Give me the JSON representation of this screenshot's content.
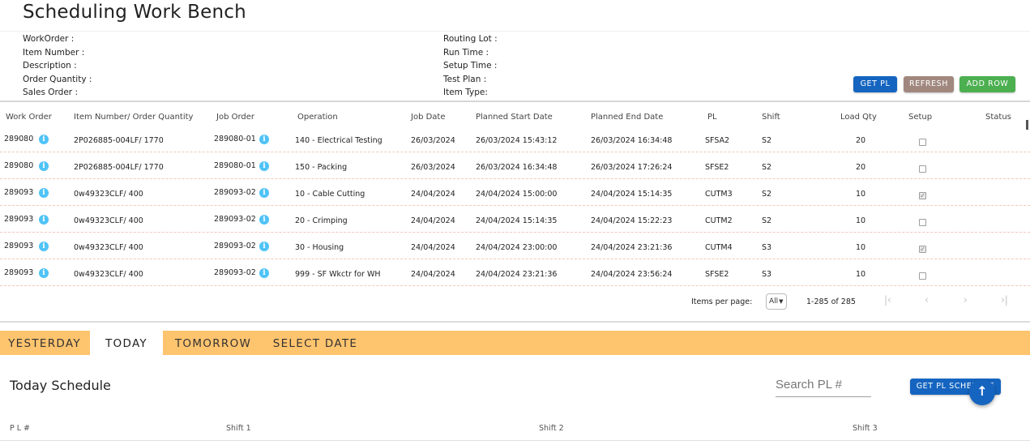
{
  "app": {
    "title": "Scheduling Work Bench"
  },
  "details_left": [
    {
      "label": "WorkOrder :"
    },
    {
      "label": "Item Number :"
    },
    {
      "label": "Description :"
    },
    {
      "label": "Order Quantity :"
    },
    {
      "label": "Sales Order :"
    }
  ],
  "details_right": [
    {
      "label": "Routing Lot :"
    },
    {
      "label": "Run Time :"
    },
    {
      "label": "Setup Time :"
    },
    {
      "label": "Test Plan :"
    },
    {
      "label": "Item Type:"
    }
  ],
  "actions": {
    "get_pl": "GET PL",
    "refresh": "REFRESH",
    "add_row": "ADD ROW"
  },
  "table": {
    "columns": [
      "Work Order",
      "Item Number/ Order Quantity",
      "Job Order",
      "Operation",
      "Job Date",
      "Planned Start Date",
      "Planned End Date",
      "PL",
      "Shift",
      "Load Qty",
      "Setup",
      "Status"
    ],
    "rows": [
      {
        "work_order": "289080",
        "item": "2P026885-004LF/ 1770",
        "job_order": "289080-01",
        "operation": "140 - Electrical Testing",
        "job_date": "26/03/2024",
        "start": "26/03/2024 15:43:12",
        "end": "26/03/2024 16:34:48",
        "pl": "SFSA2",
        "shift": "S2",
        "load_qty": "20",
        "setup_checked": false
      },
      {
        "work_order": "289080",
        "item": "2P026885-004LF/ 1770",
        "job_order": "289080-01",
        "operation": "150 - Packing",
        "job_date": "26/03/2024",
        "start": "26/03/2024 16:34:48",
        "end": "26/03/2024 17:26:24",
        "pl": "SFSE2",
        "shift": "S2",
        "load_qty": "20",
        "setup_checked": false
      },
      {
        "work_order": "289093",
        "item": "0w49323CLF/ 400",
        "job_order": "289093-02",
        "operation": "10 - Cable Cutting",
        "job_date": "24/04/2024",
        "start": "24/04/2024 15:00:00",
        "end": "24/04/2024 15:14:35",
        "pl": "CUTM3",
        "shift": "S2",
        "load_qty": "10",
        "setup_checked": true
      },
      {
        "work_order": "289093",
        "item": "0w49323CLF/ 400",
        "job_order": "289093-02",
        "operation": "20 - Crimping",
        "job_date": "24/04/2024",
        "start": "24/04/2024 15:14:35",
        "end": "24/04/2024 15:22:23",
        "pl": "CUTM2",
        "shift": "S2",
        "load_qty": "10",
        "setup_checked": false
      },
      {
        "work_order": "289093",
        "item": "0w49323CLF/ 400",
        "job_order": "289093-02",
        "operation": "30 - Housing",
        "job_date": "24/04/2024",
        "start": "24/04/2024 23:00:00",
        "end": "24/04/2024 23:21:36",
        "pl": "CUTM4",
        "shift": "S3",
        "load_qty": "10",
        "setup_checked": true
      },
      {
        "work_order": "289093",
        "item": "0w49323CLF/ 400",
        "job_order": "289093-02",
        "operation": "999 - SF Wkctr for WH",
        "job_date": "24/04/2024",
        "start": "24/04/2024 23:21:36",
        "end": "24/04/2024 23:56:24",
        "pl": "SFSE2",
        "shift": "S3",
        "load_qty": "10",
        "setup_checked": false
      }
    ]
  },
  "pagination": {
    "items_per_page_label": "Items per page:",
    "items_per_page_value": "All",
    "range_text": "1-285 of 285"
  },
  "tabs": [
    {
      "label": "YESTERDAY",
      "active": false
    },
    {
      "label": "TODAY",
      "active": true
    },
    {
      "label": "TOMORROW",
      "active": false
    },
    {
      "label": "SELECT DATE",
      "active": false
    }
  ],
  "schedule": {
    "title": "Today Schedule",
    "search_placeholder": "Search PL #",
    "get_schedule_label": "GET PL SCHEDULE",
    "columns": [
      "P L #",
      "Shift 1",
      "Shift 2",
      "Shift 3"
    ]
  },
  "colors": {
    "primary": "#1565c0",
    "refresh": "#a1887f",
    "add_row": "#4caf50",
    "tab_bar": "#ffc46e",
    "info_icon": "#4fc3f7"
  }
}
